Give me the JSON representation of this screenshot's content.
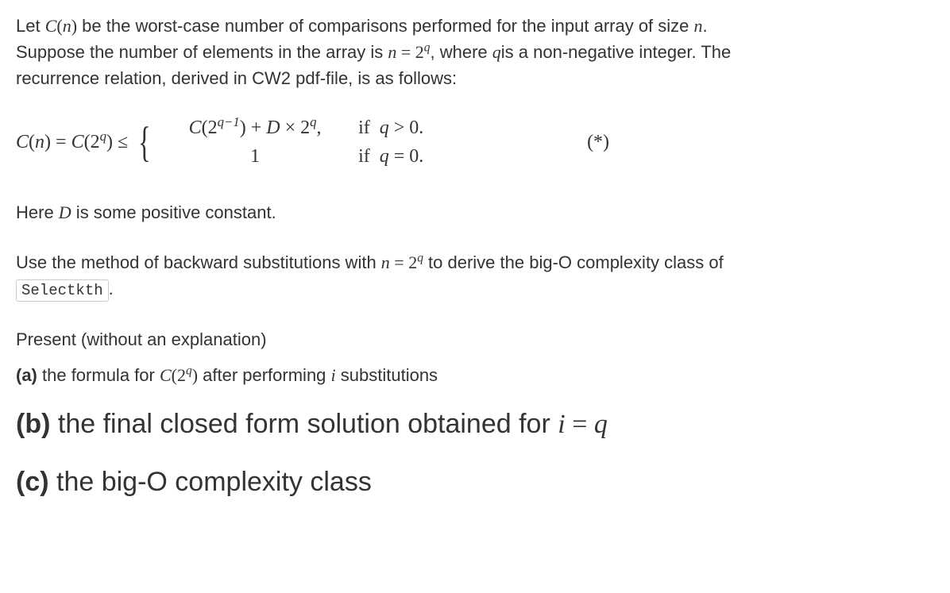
{
  "intro": {
    "line1_a": "Let ",
    "line1_b": " be the worst-case number of comparisons performed for the input array of size ",
    "line1_c": ".",
    "line2_a": "Suppose the number of elements in the array is ",
    "line2_b": ", where ",
    "line2_c": "is a non-negative integer. The",
    "line3": "recurrence relation, derived in CW2 pdf-file, is as follows:"
  },
  "math": {
    "C_of_n": "C",
    "open_paren": "(",
    "close_paren": ")",
    "n": "n",
    "eq": "=",
    "two": "2",
    "q": "q",
    "leq": "≤",
    "brace": "{",
    "case1_expr_a": "C",
    "case1_expr_b": "(2",
    "case1_exp": "q−1",
    "case1_expr_c": ") + ",
    "case1_D": "D",
    "case1_times": " × 2",
    "case1_q": "q",
    "case1_comma": ",",
    "case1_cond": "if  q > 0.",
    "case2_expr": "1",
    "case2_cond": "if  q = 0.",
    "label": "(*)",
    "i": "i"
  },
  "mid": {
    "here": "Here ",
    "D": "D",
    "rest": " is some positive constant.",
    "use_a": "Use the method of backward substitutions with ",
    "use_b": " to derive the big-O complexity class of",
    "code": "Selectkth",
    "dot": "."
  },
  "parts": {
    "present": "Present (without an explanation)",
    "a_label": "(a)",
    "a_text_1": " the formula for ",
    "a_text_2": " after performing ",
    "a_text_3": " substitutions",
    "b_label": "(b)",
    "b_text_1": " the final closed form solution obtained for ",
    "c_label": "(c)",
    "c_text": " the big-O complexity class"
  }
}
